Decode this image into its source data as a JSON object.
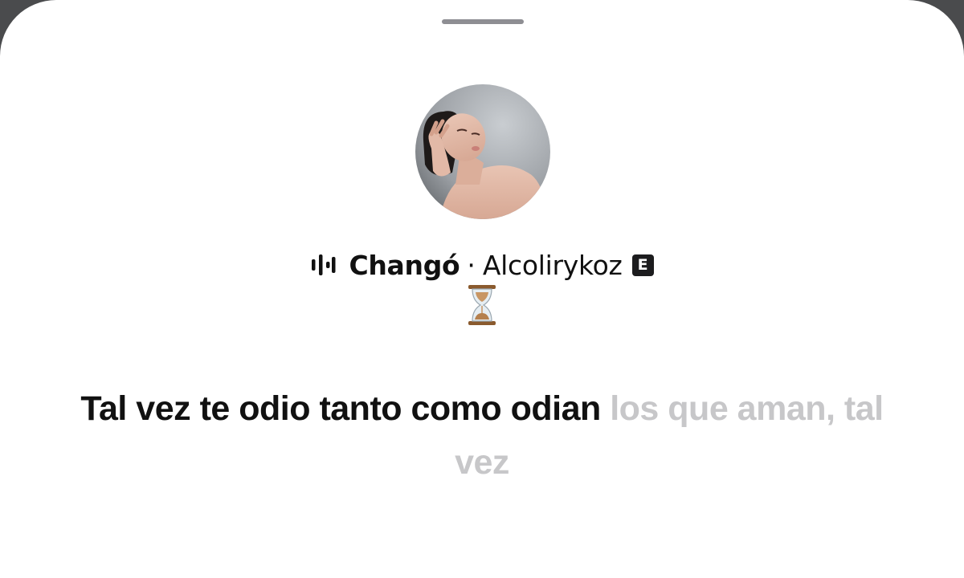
{
  "track": {
    "song_title": "Changó",
    "separator": "·",
    "artist": "Alcolirykoz",
    "explicit_badge": "E",
    "status_icon": "hourglass-icon",
    "audio_icon": "audio-waveform-icon"
  },
  "lyrics": {
    "sung": "Tal vez te odio tanto como odian",
    "upcoming": " los que aman, tal vez"
  },
  "colors": {
    "active_text": "#111111",
    "inactive_text": "#c7c7c9",
    "grabber": "#8e8e93",
    "background_outside": "#4a4b4d"
  }
}
